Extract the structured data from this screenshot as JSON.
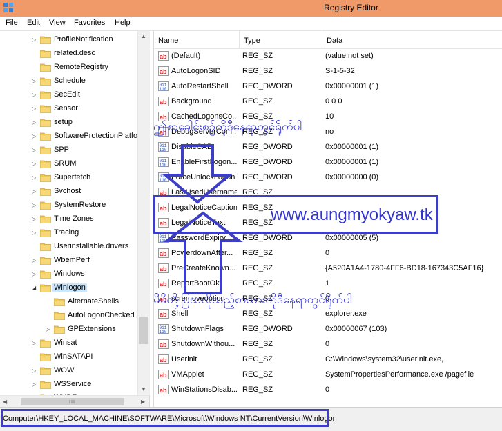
{
  "window": {
    "title": "Registry Editor"
  },
  "menu": [
    "File",
    "Edit",
    "View",
    "Favorites",
    "Help"
  ],
  "tree": {
    "items": [
      {
        "label": "ProfileNotification",
        "level": 0,
        "expander": "collapsed"
      },
      {
        "label": "related.desc",
        "level": 0,
        "expander": "none"
      },
      {
        "label": "RemoteRegistry",
        "level": 0,
        "expander": "none"
      },
      {
        "label": "Schedule",
        "level": 0,
        "expander": "collapsed"
      },
      {
        "label": "SecEdit",
        "level": 0,
        "expander": "collapsed"
      },
      {
        "label": "Sensor",
        "level": 0,
        "expander": "collapsed"
      },
      {
        "label": "setup",
        "level": 0,
        "expander": "collapsed"
      },
      {
        "label": "SoftwareProtectionPlatfo",
        "level": 0,
        "expander": "collapsed"
      },
      {
        "label": "SPP",
        "level": 0,
        "expander": "collapsed"
      },
      {
        "label": "SRUM",
        "level": 0,
        "expander": "collapsed"
      },
      {
        "label": "Superfetch",
        "level": 0,
        "expander": "collapsed"
      },
      {
        "label": "Svchost",
        "level": 0,
        "expander": "collapsed"
      },
      {
        "label": "SystemRestore",
        "level": 0,
        "expander": "collapsed"
      },
      {
        "label": "Time Zones",
        "level": 0,
        "expander": "collapsed"
      },
      {
        "label": "Tracing",
        "level": 0,
        "expander": "collapsed"
      },
      {
        "label": "Userinstallable.drivers",
        "level": 0,
        "expander": "none"
      },
      {
        "label": "WbemPerf",
        "level": 0,
        "expander": "collapsed"
      },
      {
        "label": "Windows",
        "level": 0,
        "expander": "collapsed"
      },
      {
        "label": "Winlogon",
        "level": 0,
        "expander": "expanded",
        "selected": true
      },
      {
        "label": "AlternateShells",
        "level": 1,
        "expander": "none"
      },
      {
        "label": "AutoLogonChecked",
        "level": 1,
        "expander": "none"
      },
      {
        "label": "GPExtensions",
        "level": 1,
        "expander": "collapsed"
      },
      {
        "label": "Winsat",
        "level": 0,
        "expander": "collapsed"
      },
      {
        "label": "WinSATAPI",
        "level": 0,
        "expander": "none"
      },
      {
        "label": "WOW",
        "level": 0,
        "expander": "collapsed"
      },
      {
        "label": "WSService",
        "level": 0,
        "expander": "collapsed"
      },
      {
        "label": "WUDF",
        "level": 0,
        "expander": "collapsed"
      }
    ]
  },
  "values": {
    "columns": [
      "Name",
      "Type",
      "Data"
    ],
    "rows": [
      {
        "icon": "ab",
        "name": "(Default)",
        "type": "REG_SZ",
        "data": "(value not set)"
      },
      {
        "icon": "ab",
        "name": "AutoLogonSID",
        "type": "REG_SZ",
        "data": "S-1-5-32"
      },
      {
        "icon": "bin",
        "name": "AutoRestartShell",
        "type": "REG_DWORD",
        "data": "0x00000001 (1)"
      },
      {
        "icon": "ab",
        "name": "Background",
        "type": "REG_SZ",
        "data": "0 0 0"
      },
      {
        "icon": "ab",
        "name": "CachedLogonsCo...",
        "type": "REG_SZ",
        "data": "10"
      },
      {
        "icon": "ab",
        "name": "DebugServerCom...",
        "type": "REG_SZ",
        "data": "no"
      },
      {
        "icon": "bin",
        "name": "DisableCAD",
        "type": "REG_DWORD",
        "data": "0x00000001 (1)"
      },
      {
        "icon": "bin",
        "name": "EnableFirstLogon...",
        "type": "REG_DWORD",
        "data": "0x00000001 (1)"
      },
      {
        "icon": "bin",
        "name": "ForceUnlockLogon",
        "type": "REG_DWORD",
        "data": "0x00000000 (0)"
      },
      {
        "icon": "ab",
        "name": "LastUsedUsername",
        "type": "REG_SZ",
        "data": ""
      },
      {
        "icon": "ab",
        "name": "LegalNoticeCaption",
        "type": "REG_SZ",
        "data": ""
      },
      {
        "icon": "ab",
        "name": "LegalNoticeText",
        "type": "REG_SZ",
        "data": ""
      },
      {
        "icon": "bin",
        "name": "PasswordExpiry...",
        "type": "REG_DWORD",
        "data": "0x00000005 (5)"
      },
      {
        "icon": "ab",
        "name": "PowerdownAfter...",
        "type": "REG_SZ",
        "data": "0"
      },
      {
        "icon": "ab",
        "name": "PreCreateKnown...",
        "type": "REG_SZ",
        "data": "{A520A1A4-1780-4FF6-BD18-167343C5AF16}"
      },
      {
        "icon": "ab",
        "name": "ReportBootOk",
        "type": "REG_SZ",
        "data": "1"
      },
      {
        "icon": "ab",
        "name": "scremoveoption",
        "type": "REG_SZ",
        "data": "0"
      },
      {
        "icon": "ab",
        "name": "Shell",
        "type": "REG_SZ",
        "data": "explorer.exe"
      },
      {
        "icon": "bin",
        "name": "ShutdownFlags",
        "type": "REG_DWORD",
        "data": "0x00000067 (103)"
      },
      {
        "icon": "ab",
        "name": "ShutdownWithou...",
        "type": "REG_SZ",
        "data": "0"
      },
      {
        "icon": "ab",
        "name": "Userinit",
        "type": "REG_SZ",
        "data": "C:\\Windows\\system32\\userinit.exe,"
      },
      {
        "icon": "ab",
        "name": "VMApplet",
        "type": "REG_SZ",
        "data": "SystemPropertiesPerformance.exe /pagefile"
      },
      {
        "icon": "ab",
        "name": "WinStationsDisab...",
        "type": "REG_SZ",
        "data": "0"
      }
    ]
  },
  "status": {
    "path": "Computer\\HKEY_LOCAL_MACHINE\\SOFTWARE\\Microsoft\\Windows NT\\CurrentVersion\\Winlogon"
  },
  "annotations": {
    "caption_hint": "ဤစာခေါင်းစဉ်ကိုဒီနေရာတွင်ရိုက်ပါ",
    "text_hint": "မိမိတို့ပြသလိုသည့်စာသားကိုဒီနေရာတွင်ရိုက်ပါ",
    "watermark": "www.aungmyokyaw.tk"
  },
  "colors": {
    "titlebar": "#f09a6a",
    "annotation_blue": "#3c3fc6",
    "folder_yellow": "#f2c94c",
    "ab_icon_red": "#c62828",
    "bin_icon_blue": "#1f4fbf"
  }
}
